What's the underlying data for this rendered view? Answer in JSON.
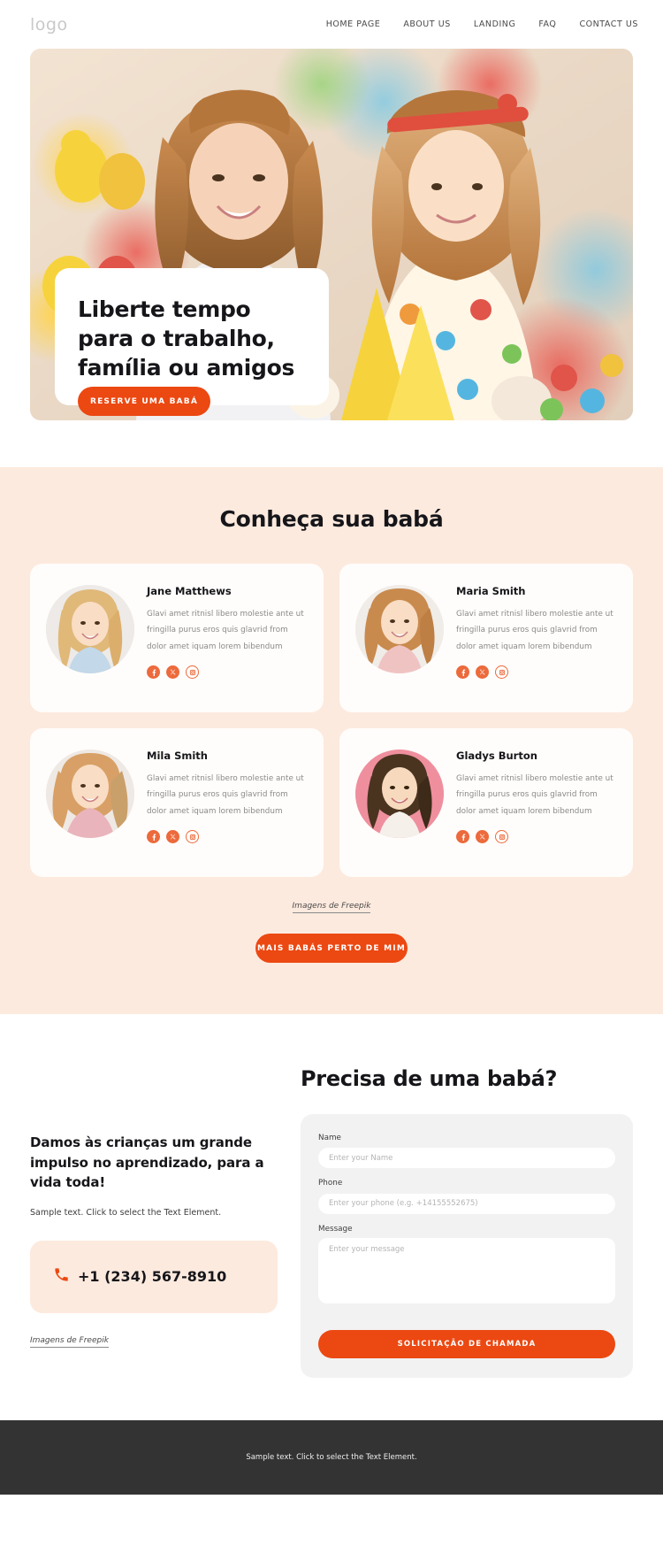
{
  "header": {
    "logo": "logo",
    "nav": [
      {
        "label": "HOME PAGE"
      },
      {
        "label": "ABOUT US"
      },
      {
        "label": "LANDING"
      },
      {
        "label": "FAQ"
      },
      {
        "label": "CONTACT US"
      }
    ]
  },
  "hero": {
    "title": "Liberte tempo para o trabalho, família ou amigos",
    "cta": "RESERVE UMA BABÁ"
  },
  "team": {
    "title": "Conheça sua babá",
    "bio": "Glavi amet ritnisl libero molestie ante ut fringilla purus eros quis glavrid from dolor amet iquam lorem bibendum",
    "members": [
      {
        "name": "Jane Matthews"
      },
      {
        "name": "Maria Smith"
      },
      {
        "name": "Mila Smith"
      },
      {
        "name": "Gladys Burton"
      }
    ],
    "socials": [
      {
        "name": "facebook-icon"
      },
      {
        "name": "x-twitter-icon"
      },
      {
        "name": "instagram-icon"
      }
    ],
    "credit": "Imagens de Freepik",
    "cta": "MAIS BABÁS PERTO DE MIM"
  },
  "contact": {
    "heading": "Damos às crianças um grande impulso no aprendizado, para a vida toda!",
    "subtext": "Sample text. Click to select the Text Element.",
    "phone": "+1 (234) 567-8910",
    "credit": "Imagens de Freepik",
    "form_heading": "Precisa de uma babá?",
    "fields": {
      "name_label": "Name",
      "name_placeholder": "Enter your Name",
      "phone_label": "Phone",
      "phone_placeholder": "Enter your phone (e.g. +14155552675)",
      "message_label": "Message",
      "message_placeholder": "Enter your message"
    },
    "submit": "SOLICITAÇÃO DE CHAMADA"
  },
  "footer": {
    "text": "Sample text. Click to select the Text Element."
  },
  "colors": {
    "accent": "#ec4812",
    "social": "#ec6a3c",
    "section_bg": "#fdeade",
    "footer_bg": "#333333"
  }
}
